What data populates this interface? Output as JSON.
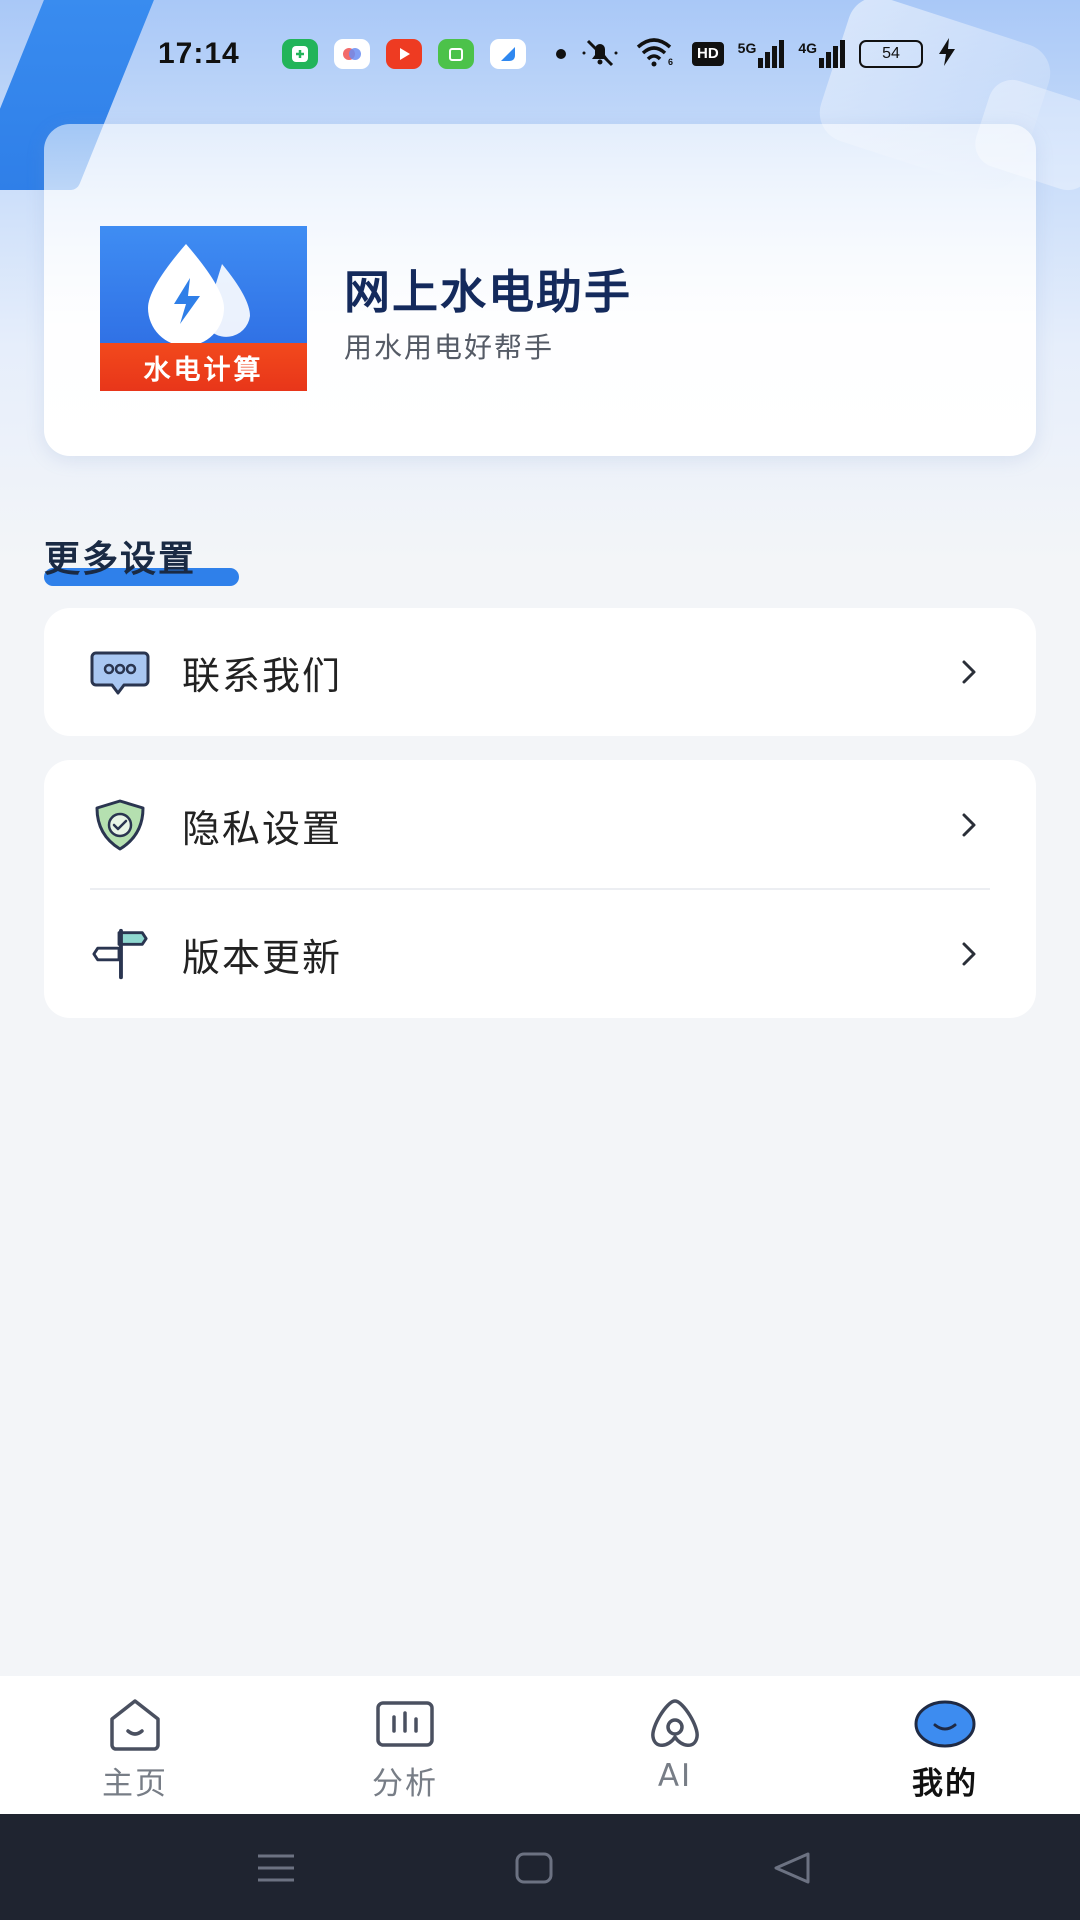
{
  "status_bar": {
    "time": "17:14",
    "network_hd": "HD",
    "net_5g": "5G",
    "net_4g": "4G",
    "battery": "54"
  },
  "header": {
    "app_name": "网上水电助手",
    "slogan": "用水用电好帮手",
    "logo_text": "水电计算",
    "colors": {
      "logo_blue": "#2f7fe8",
      "logo_band": "#ee3f1b",
      "title": "#142a5c"
    }
  },
  "section": {
    "title": "更多设置"
  },
  "menu": {
    "contact": {
      "label": "联系我们",
      "icon": "chat-bubble-icon"
    },
    "privacy": {
      "label": "隐私设置",
      "icon": "shield-check-icon"
    },
    "update": {
      "label": "版本更新",
      "icon": "signpost-icon"
    }
  },
  "tabs": [
    {
      "label": "主页",
      "icon": "home-icon",
      "active": false
    },
    {
      "label": "分析",
      "icon": "chart-icon",
      "active": false
    },
    {
      "label": "AI",
      "icon": "ai-icon",
      "active": false
    },
    {
      "label": "我的",
      "icon": "profile-icon",
      "active": true
    }
  ],
  "accent_color": "#2f80ea"
}
